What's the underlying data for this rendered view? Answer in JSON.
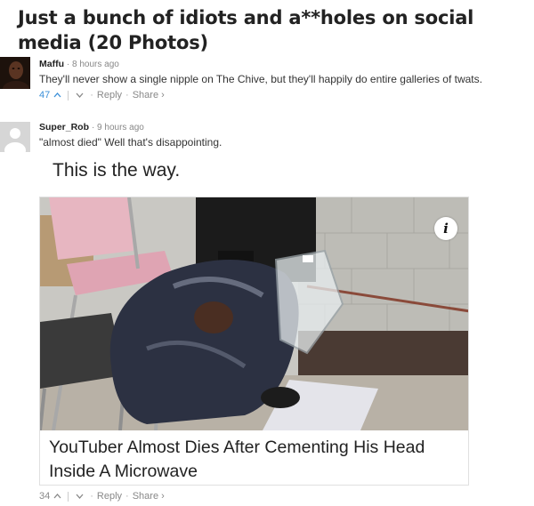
{
  "page": {
    "title": "Just a bunch of idiots and a**holes on social media (20 Photos)"
  },
  "comments": [
    {
      "username": "Maffu",
      "timestamp": "8 hours ago",
      "text": "They'll never show a single nipple on The Chive, but they'll happily do entire galleries of twats.",
      "votes": "47",
      "reply_label": "Reply",
      "share_label": "Share ›"
    },
    {
      "username": "Super_Rob",
      "timestamp": "9 hours ago",
      "text": "\"almost died\" Well that's disappointing.",
      "votes": "34",
      "reply_label": "Reply",
      "share_label": "Share ›"
    }
  ],
  "embed": {
    "caption": "This is the way.",
    "info_icon": "i",
    "headline": "YouTuber Almost Dies After Cementing His Head Inside A Microwave"
  },
  "colors": {
    "vote_count_blue": "#3a8fd8",
    "meta_gray": "#888888"
  },
  "icons": [
    "upvote-icon",
    "downvote-icon",
    "info-icon",
    "avatar-default-icon"
  ]
}
